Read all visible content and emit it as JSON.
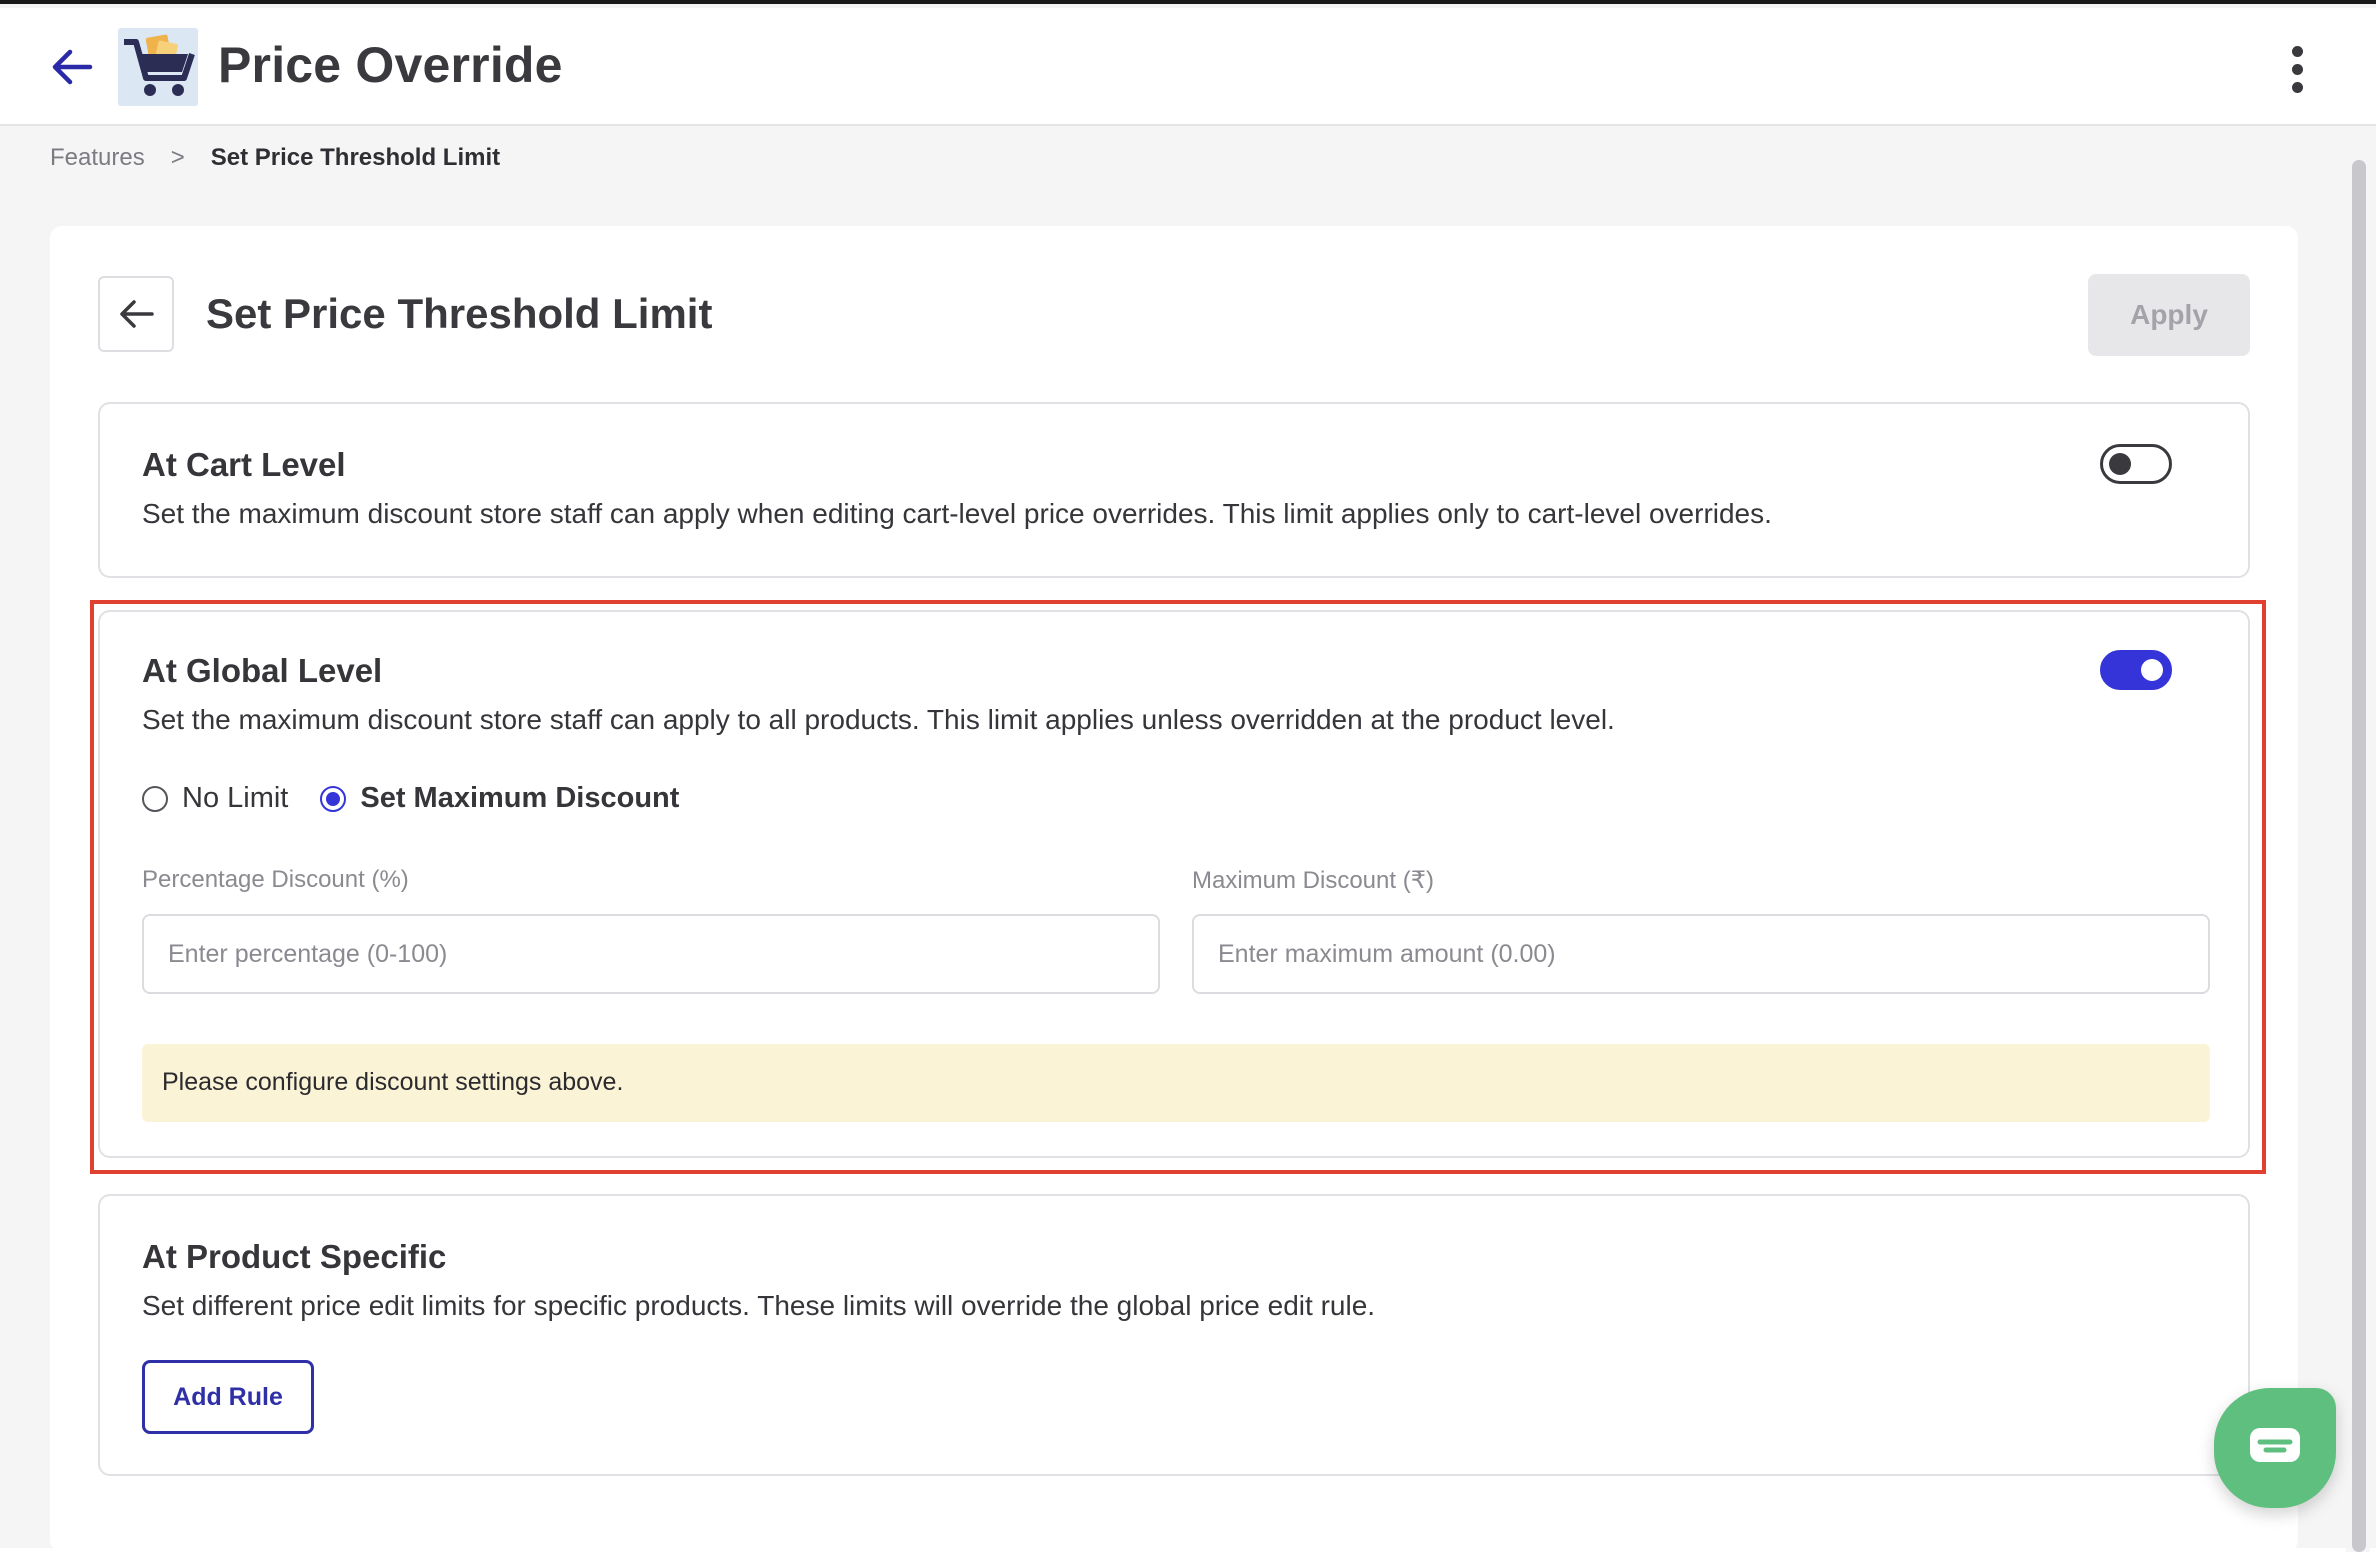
{
  "header": {
    "title": "Price Override",
    "back_icon": "arrow-left-icon",
    "logo_icon": "shopping-cart-logo",
    "menu_icon": "kebab-menu-icon"
  },
  "breadcrumb": {
    "items": [
      "Features",
      "Set Price Threshold Limit"
    ],
    "separator": ">"
  },
  "page": {
    "title": "Set Price Threshold Limit",
    "apply_label": "Apply"
  },
  "cart_level": {
    "title": "At Cart Level",
    "description": "Set the maximum discount store staff can apply when editing cart-level price overrides. This limit applies only to cart-level overrides.",
    "enabled": false
  },
  "global_level": {
    "title": "At Global Level",
    "description": "Set the maximum discount store staff can apply to all products. This limit applies unless overridden at the product level.",
    "enabled": true,
    "options": [
      "No Limit",
      "Set Maximum Discount"
    ],
    "selected": "Set Maximum Discount",
    "percentage_label": "Percentage Discount (%)",
    "percentage_placeholder": "Enter percentage (0-100)",
    "max_label": "Maximum Discount (₹)",
    "max_placeholder": "Enter maximum amount (0.00)",
    "notice": "Please configure discount settings above."
  },
  "product_specific": {
    "title": "At Product Specific",
    "description": "Set different price edit limits for specific products. These limits will override the global price edit rule.",
    "add_rule_label": "Add Rule"
  },
  "colors": {
    "accent": "#3434d8",
    "highlight": "#e04030",
    "notice_bg": "#fbf3d6",
    "chat": "#5fbf7e"
  }
}
